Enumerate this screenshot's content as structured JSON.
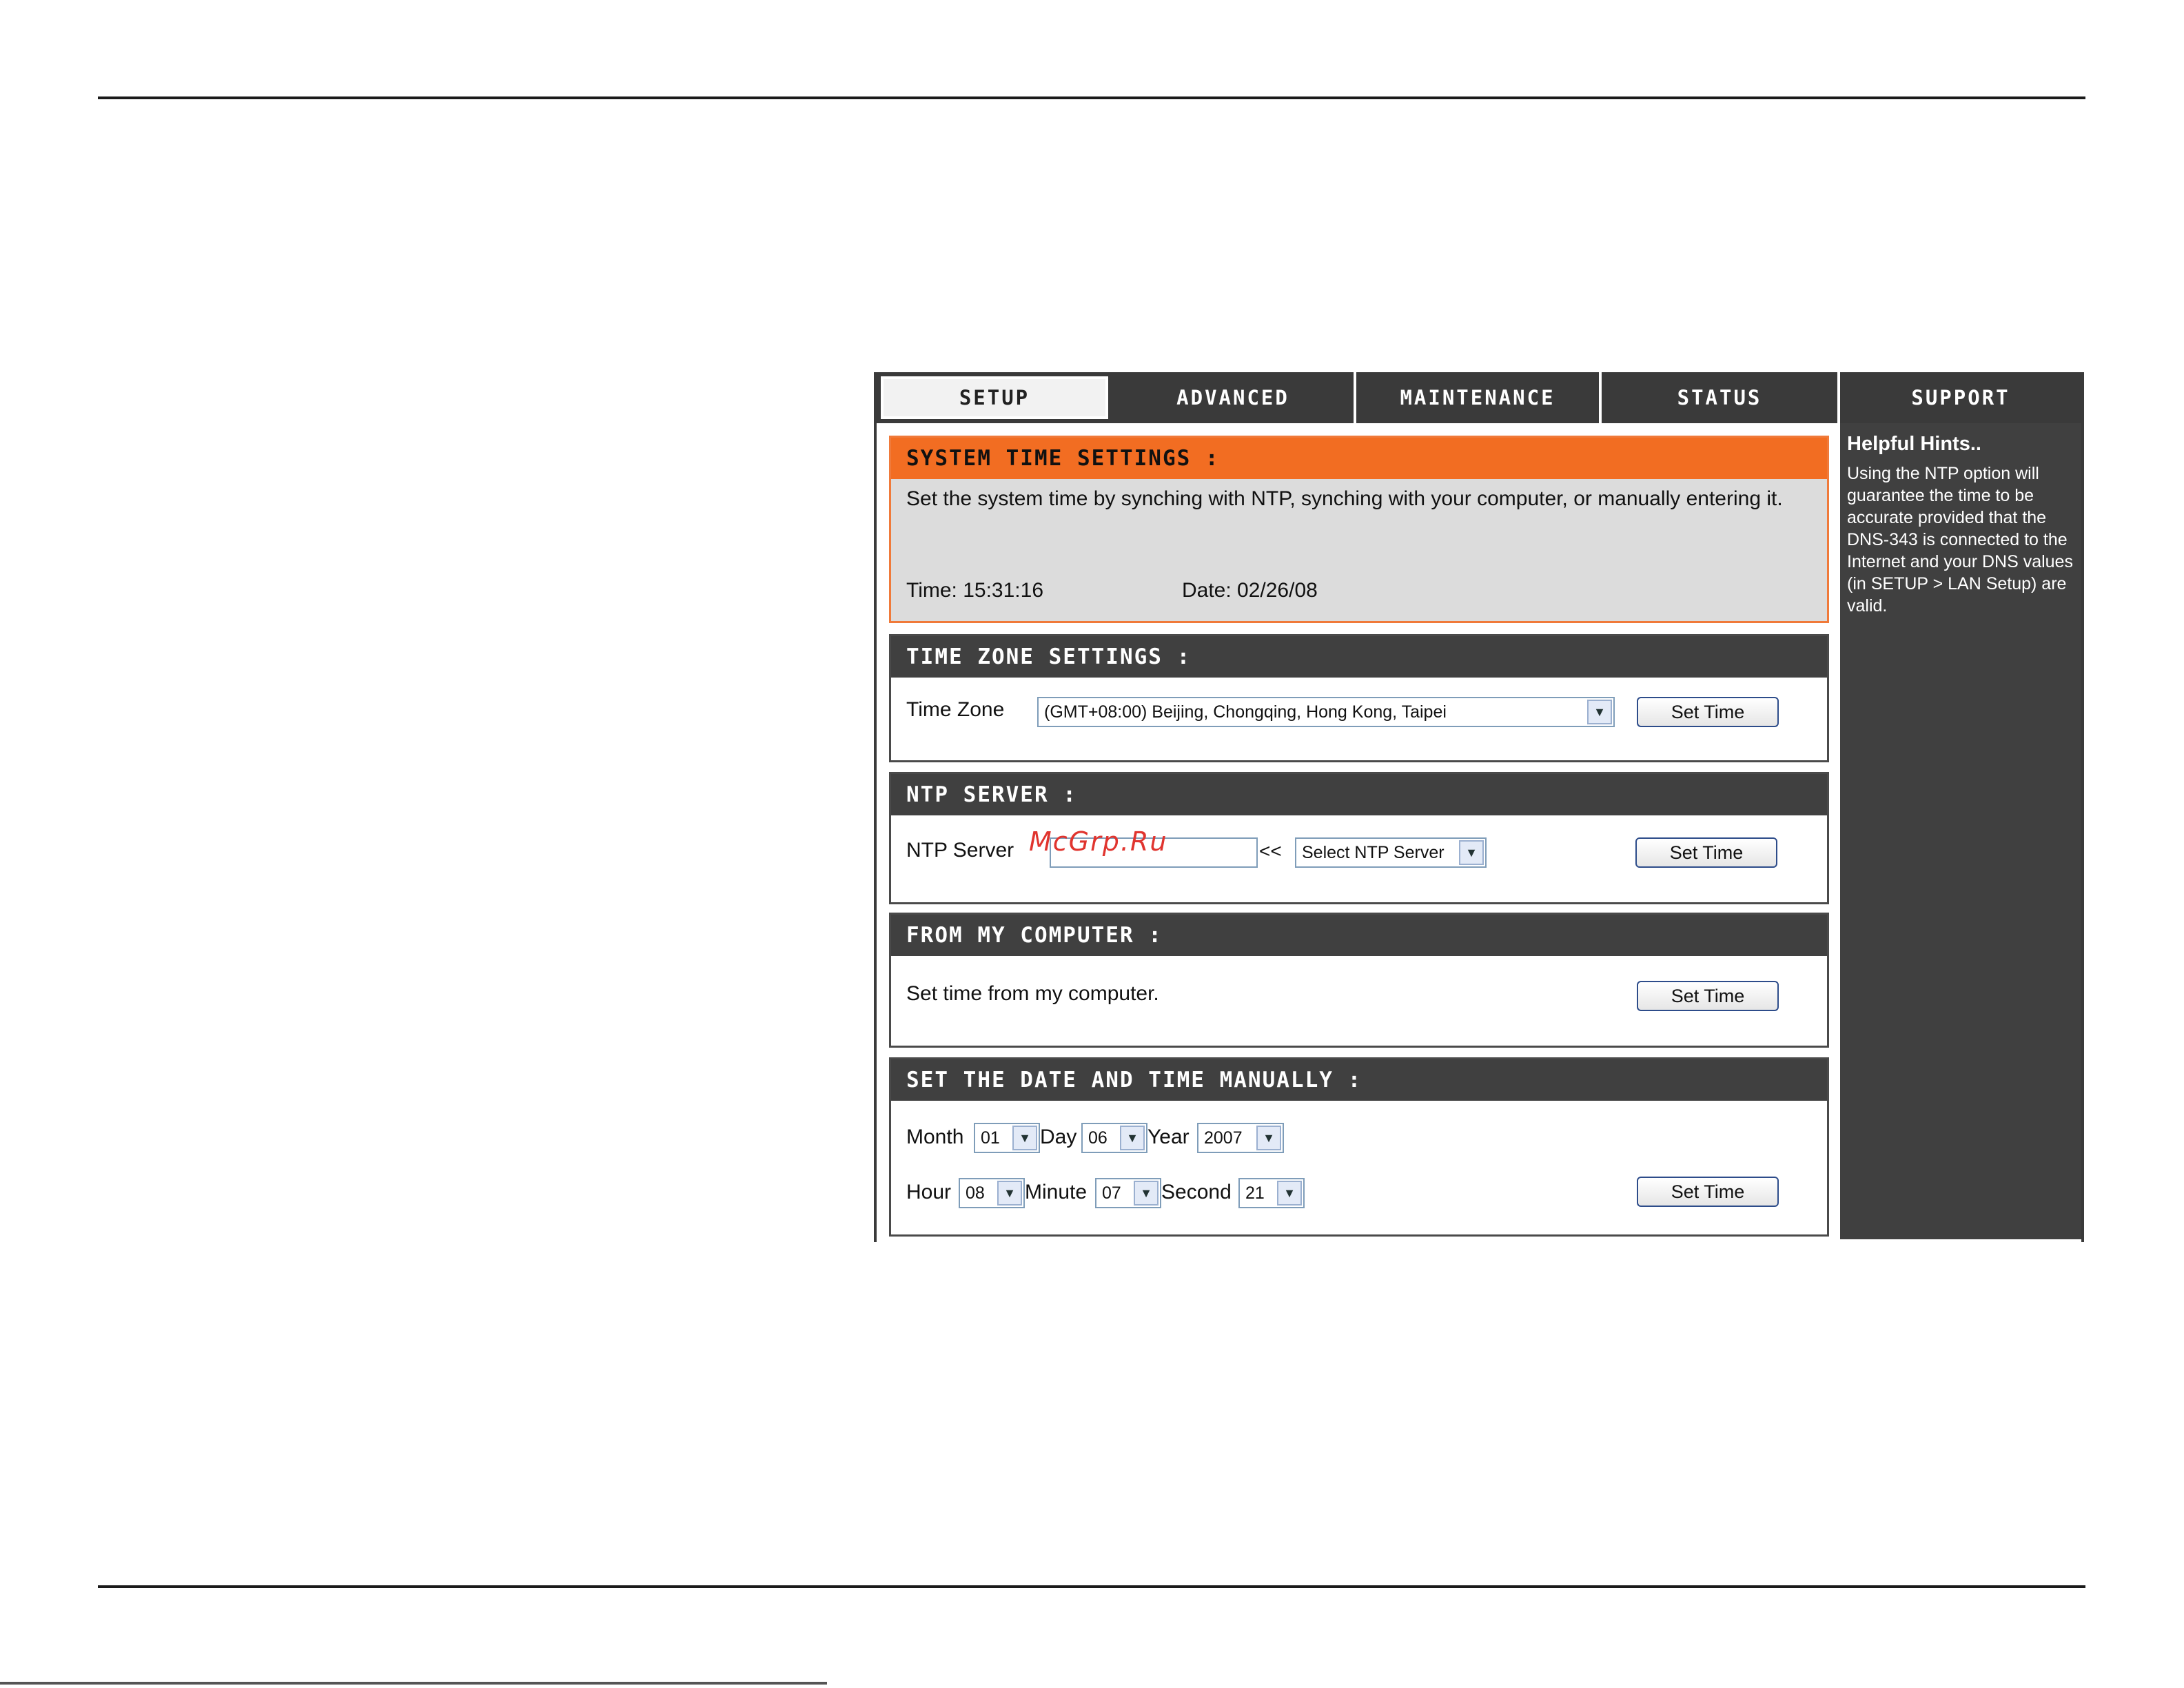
{
  "tabs": [
    {
      "label": "SETUP",
      "active": true
    },
    {
      "label": "ADVANCED",
      "active": false
    },
    {
      "label": "MAINTENANCE",
      "active": false
    },
    {
      "label": "STATUS",
      "active": false
    },
    {
      "label": "SUPPORT",
      "active": false
    }
  ],
  "hints": {
    "title": "Helpful Hints..",
    "text": "Using the NTP option will guarantee the time to be accurate provided that the DNS-343 is connected to the Internet and your DNS values (in SETUP > LAN Setup) are valid."
  },
  "system_time": {
    "header": "SYSTEM TIME SETTINGS :",
    "description": "Set the system time by synching with NTP, synching with your computer, or manually entering it.",
    "time_label": "Time: 15:31:16",
    "date_label": "Date: 02/26/08"
  },
  "time_zone": {
    "header": "TIME ZONE SETTINGS :",
    "label": "Time Zone",
    "selected": "(GMT+08:00) Beijing, Chongqing, Hong Kong, Taipei",
    "button": "Set Time"
  },
  "ntp": {
    "header": "NTP SERVER :",
    "label": "NTP Server",
    "input_value": "",
    "arrows": "<<",
    "select": "Select NTP Server",
    "button": "Set Time"
  },
  "computer": {
    "header": "FROM MY COMPUTER :",
    "text": "Set time from my computer.",
    "button": "Set Time"
  },
  "manual": {
    "header": "SET THE DATE AND TIME MANUALLY :",
    "month_label": "Month",
    "month": "01",
    "day_label": "Day",
    "day": "06",
    "year_label": "Year",
    "year": "2007",
    "hour_label": "Hour",
    "hour": "08",
    "minute_label": "Minute",
    "minute": "07",
    "second_label": "Second",
    "second": "21",
    "button": "Set Time"
  },
  "watermark": "McGrp.Ru",
  "icons": {
    "dropdown": "chevron-down-icon"
  },
  "colors": {
    "orange": "#f26d22",
    "dark": "#404040"
  }
}
